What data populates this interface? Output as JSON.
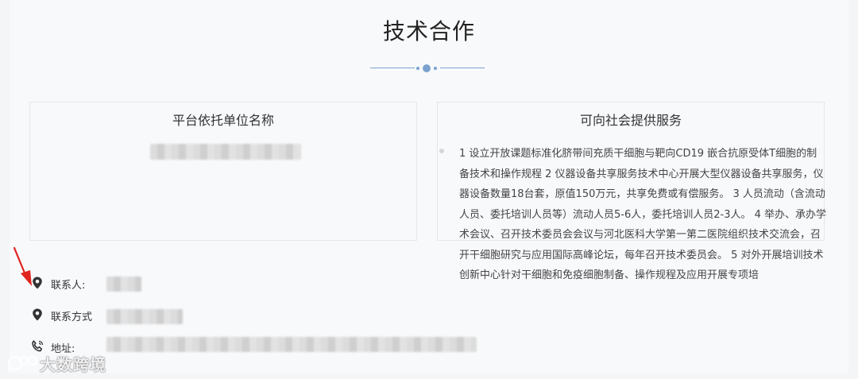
{
  "page": {
    "title": "技术合作",
    "accent_color": "#7aa1cf"
  },
  "unit_card": {
    "title": "平台依托单位名称"
  },
  "services_card": {
    "title": "可向社会提供服务",
    "text": "1 设立开放课题标准化脐带间充质干细胞与靶向CD19 嵌合抗原受体T细胞的制备技术和操作规程 2 仪器设备共享服务技术中心开展大型仪器设备共享服务，仪器设备数量18台套，原值150万元，共享免费或有偿服务。 3 人员流动（含流动人员、委托培训人员等）流动人员5-6人，委托培训人员2-3人。 4 举办、承办学术会议、召开技术委员会会议与河北医科大学第一第二医院组织技术交流会，召开干细胞研究与应用国际高峰论坛，每年召开技术委员会。 5 对外开展培训技术创新中心针对干细胞和免疫细胞制备、操作规程及应用开展专项培"
  },
  "contacts": {
    "person_label": "联系人:",
    "method_label": "联系方式",
    "address_label": "地址:",
    "person_icon": "location-pin-icon",
    "method_icon": "location-pin-icon",
    "address_icon": "phone-icon"
  },
  "annotation": {
    "arrow_color": "#e0231e"
  },
  "watermark": {
    "text": "大数跨境",
    "icon": "chat-bubbles-icon"
  }
}
